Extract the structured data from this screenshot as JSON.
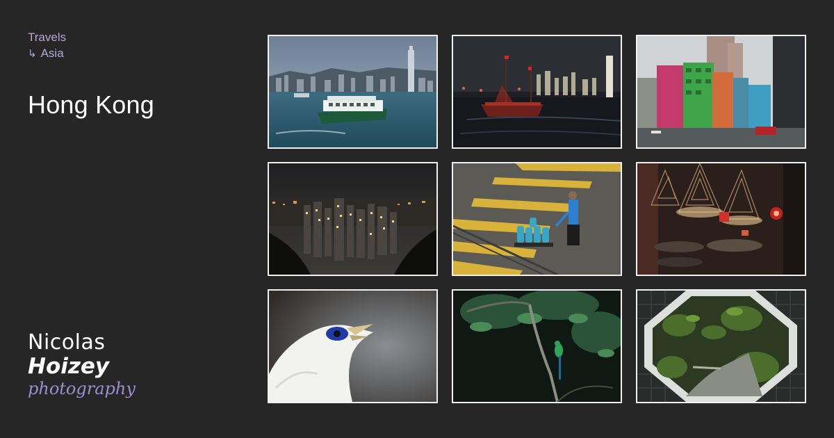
{
  "breadcrumb": {
    "items": [
      {
        "label": "Travels"
      },
      {
        "label": "Asia",
        "prefix": "↳"
      }
    ]
  },
  "page": {
    "title": "Hong Kong"
  },
  "logo": {
    "first_name": "Nicolas",
    "last_name": "Hoizey",
    "tagline": "photography"
  },
  "colors": {
    "background": "#262626",
    "accent": "#b7a6d8",
    "photo_border": "#f2f2f2"
  },
  "gallery": {
    "photos": [
      {
        "subject": "star-ferry-harbour"
      },
      {
        "subject": "red-sail-junk-night"
      },
      {
        "subject": "colorful-buildings-street"
      },
      {
        "subject": "city-night-from-peak"
      },
      {
        "subject": "gas-cylinder-worker"
      },
      {
        "subject": "incense-coils-temple"
      },
      {
        "subject": "white-bird-portrait"
      },
      {
        "subject": "green-bird-foliage"
      },
      {
        "subject": "octagonal-garden-gate"
      }
    ]
  }
}
